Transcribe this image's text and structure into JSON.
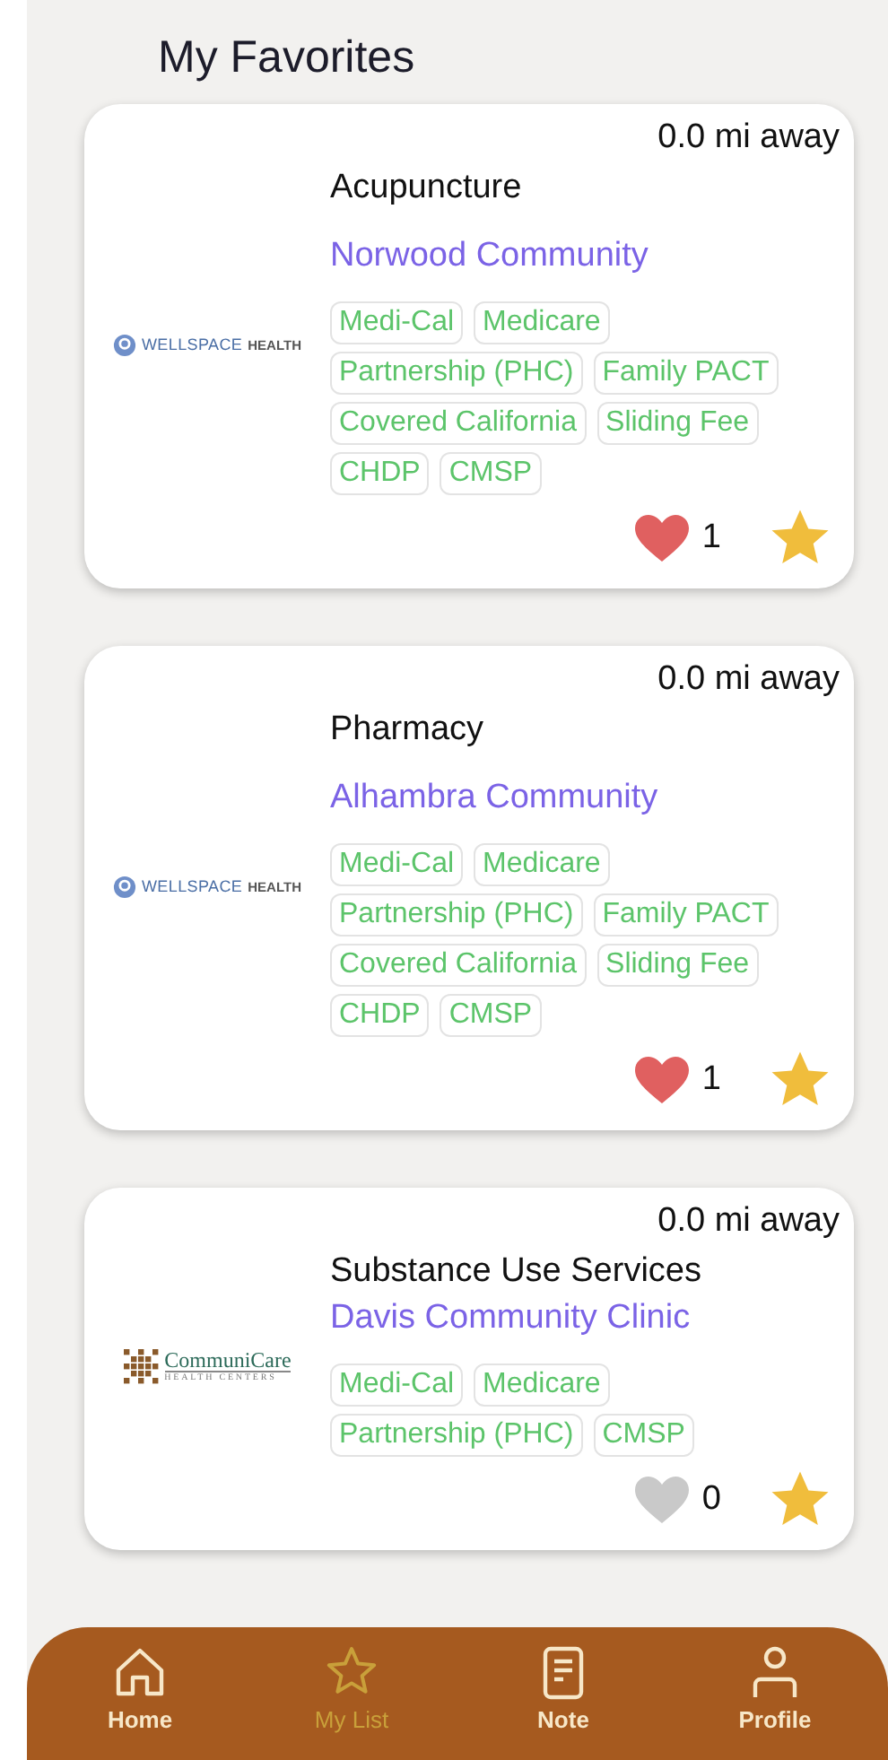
{
  "title": "My Favorites",
  "favorites": [
    {
      "distance": "0.0 mi away",
      "service": "Acupuncture",
      "clinic": "Norwood Community",
      "logo": {
        "kind": "wellspace",
        "name": "WELLSPACE",
        "suffix": "HEALTH"
      },
      "tags": [
        "Medi-Cal",
        "Medicare",
        "Partnership (PHC)",
        "Family PACT",
        "Covered California",
        "Sliding Fee",
        "CHDP",
        "CMSP"
      ],
      "liked": true,
      "likes": "1",
      "starred": true
    },
    {
      "distance": "0.0 mi away",
      "service": "Pharmacy",
      "clinic": "Alhambra Community",
      "logo": {
        "kind": "wellspace",
        "name": "WELLSPACE",
        "suffix": "HEALTH"
      },
      "tags": [
        "Medi-Cal",
        "Medicare",
        "Partnership (PHC)",
        "Family PACT",
        "Covered California",
        "Sliding Fee",
        "CHDP",
        "CMSP"
      ],
      "liked": true,
      "likes": "1",
      "starred": true
    },
    {
      "distance": "0.0 mi away",
      "service": "Substance Use Services",
      "clinic": "Davis Community Clinic",
      "logo": {
        "kind": "communicare",
        "name": "CommuniCare",
        "suffix": "HEALTH CENTERS"
      },
      "tags": [
        "Medi-Cal",
        "Medicare",
        "Partnership (PHC)",
        "CMSP"
      ],
      "liked": false,
      "likes": "0",
      "starred": true
    }
  ],
  "tab_bar": [
    {
      "label": "Home",
      "kind": "home",
      "selected": false
    },
    {
      "label": "My List",
      "kind": "star",
      "selected": true
    },
    {
      "label": "Note",
      "kind": "note",
      "selected": false
    },
    {
      "label": "Profile",
      "kind": "person",
      "selected": false
    }
  ]
}
